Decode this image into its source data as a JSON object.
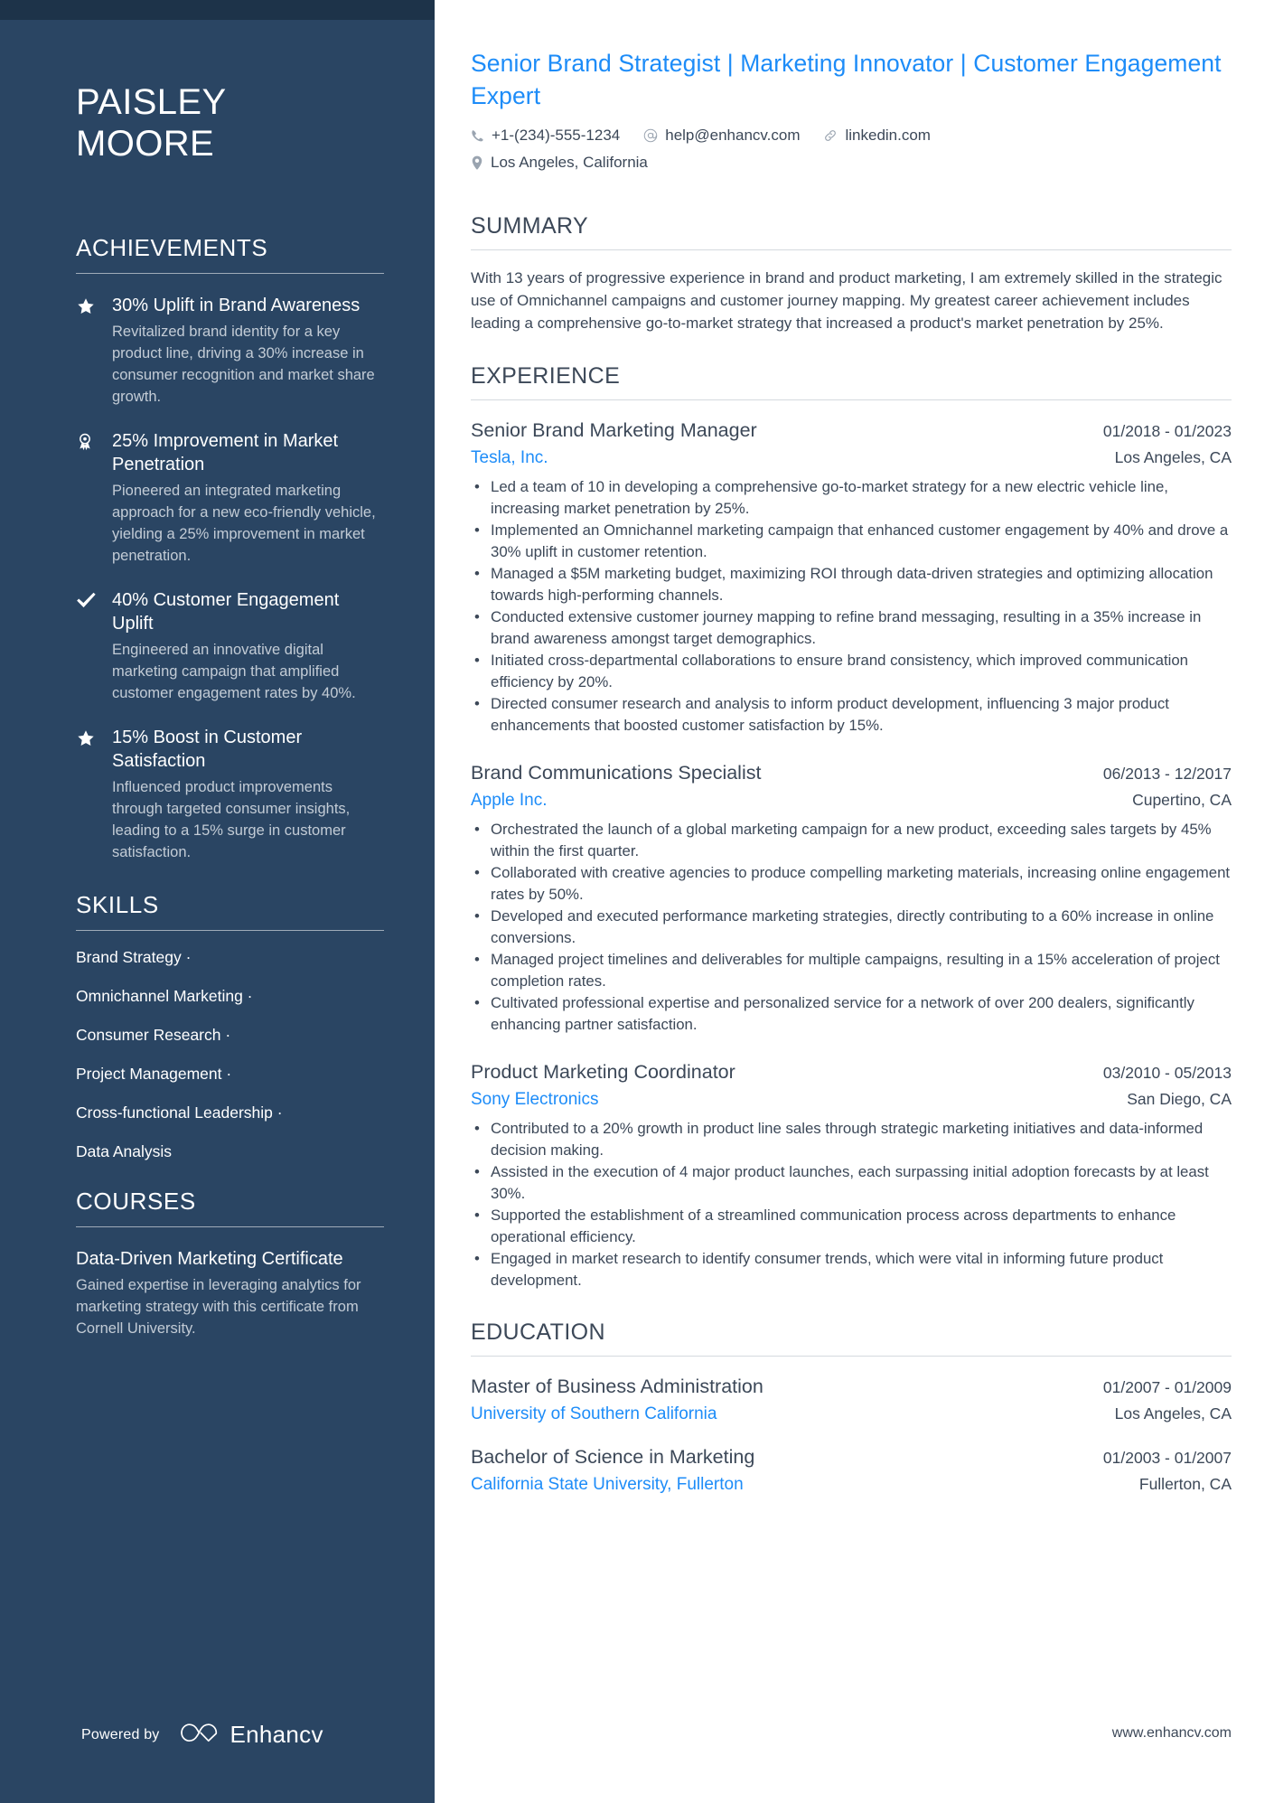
{
  "sidebar": {
    "name_first": "PAISLEY",
    "name_last": "MOORE",
    "achievements": {
      "title": "ACHIEVEMENTS",
      "items": [
        {
          "icon": "star-icon",
          "title": "30% Uplift in Brand Awareness",
          "description": "Revitalized brand identity for a key product line, driving a 30% increase in consumer recognition and market share growth."
        },
        {
          "icon": "award-ribbon-icon",
          "title": "25% Improvement in Market Penetration",
          "description": "Pioneered an integrated marketing approach for a new eco-friendly vehicle, yielding a 25% improvement in market penetration."
        },
        {
          "icon": "check-icon",
          "title": "40% Customer Engagement Uplift",
          "description": "Engineered an innovative digital marketing campaign that amplified customer engagement rates by 40%."
        },
        {
          "icon": "star-icon",
          "title": "15% Boost in Customer Satisfaction",
          "description": "Influenced product improvements through targeted consumer insights, leading to a 15% surge in customer satisfaction."
        }
      ]
    },
    "skills": {
      "title": "SKILLS",
      "items": [
        "Brand Strategy ·",
        "Omnichannel Marketing ·",
        "Consumer Research ·",
        "Project Management ·",
        "Cross-functional Leadership ·",
        "Data Analysis"
      ]
    },
    "courses": {
      "title": "COURSES",
      "items": [
        {
          "title": "Data-Driven Marketing Certificate",
          "description": "Gained expertise in leveraging analytics for marketing strategy with this certificate from Cornell University."
        }
      ]
    },
    "footer": {
      "powered_by": "Powered by",
      "brand": "Enhancv"
    }
  },
  "main": {
    "headline": "Senior Brand Strategist | Marketing Innovator | Customer Engagement Expert",
    "contact": {
      "phone": "+1-(234)-555-1234",
      "email": "help@enhancv.com",
      "link": "linkedin.com",
      "location": "Los Angeles, California"
    },
    "summary": {
      "title": "SUMMARY",
      "text": "With 13 years of progressive experience in brand and product marketing, I am extremely skilled in the strategic use of Omnichannel campaigns and customer journey mapping. My greatest career achievement includes leading a comprehensive go-to-market strategy that increased a product's market penetration by 25%."
    },
    "experience": {
      "title": "EXPERIENCE",
      "entries": [
        {
          "role": "Senior Brand Marketing Manager",
          "date": "01/2018 - 01/2023",
          "company": "Tesla, Inc.",
          "location": "Los Angeles, CA",
          "bullets": [
            "Led a team of 10 in developing a comprehensive go-to-market strategy for a new electric vehicle line, increasing market penetration by 25%.",
            "Implemented an Omnichannel marketing campaign that enhanced customer engagement by 40% and drove a 30% uplift in customer retention.",
            "Managed a $5M marketing budget, maximizing ROI through data-driven strategies and optimizing allocation towards high-performing channels.",
            "Conducted extensive customer journey mapping to refine brand messaging, resulting in a 35% increase in brand awareness amongst target demographics.",
            "Initiated cross-departmental collaborations to ensure brand consistency, which improved communication efficiency by 20%.",
            "Directed consumer research and analysis to inform product development, influencing 3 major product enhancements that boosted customer satisfaction by 15%."
          ]
        },
        {
          "role": "Brand Communications Specialist",
          "date": "06/2013 - 12/2017",
          "company": "Apple Inc.",
          "location": "Cupertino, CA",
          "bullets": [
            "Orchestrated the launch of a global marketing campaign for a new product, exceeding sales targets by 45% within the first quarter.",
            "Collaborated with creative agencies to produce compelling marketing materials, increasing online engagement rates by 50%.",
            "Developed and executed performance marketing strategies, directly contributing to a 60% increase in online conversions.",
            "Managed project timelines and deliverables for multiple campaigns, resulting in a 15% acceleration of project completion rates.",
            "Cultivated professional expertise and personalized service for a network of over 200 dealers, significantly enhancing partner satisfaction."
          ]
        },
        {
          "role": "Product Marketing Coordinator",
          "date": "03/2010 - 05/2013",
          "company": "Sony Electronics",
          "location": "San Diego, CA",
          "bullets": [
            "Contributed to a 20% growth in product line sales through strategic marketing initiatives and data-informed decision making.",
            "Assisted in the execution of 4 major product launches, each surpassing initial adoption forecasts by at least 30%.",
            "Supported the establishment of a streamlined communication process across departments to enhance operational efficiency.",
            "Engaged in market research to identify consumer trends, which were vital in informing future product development."
          ]
        }
      ]
    },
    "education": {
      "title": "EDUCATION",
      "entries": [
        {
          "degree": "Master of Business Administration",
          "date": "01/2007 - 01/2009",
          "school": "University of Southern California",
          "location": "Los Angeles, CA"
        },
        {
          "degree": "Bachelor of Science in Marketing",
          "date": "01/2003 - 01/2007",
          "school": "California State University, Fullerton",
          "location": "Fullerton, CA"
        }
      ]
    },
    "footer_url": "www.enhancv.com"
  },
  "colors": {
    "sidebar_bg": "#2a4563",
    "sidebar_topbar": "#1d3349",
    "accent_blue": "#1d8cf8",
    "body_text": "#3c4858",
    "muted_text": "#c3ccd6"
  }
}
